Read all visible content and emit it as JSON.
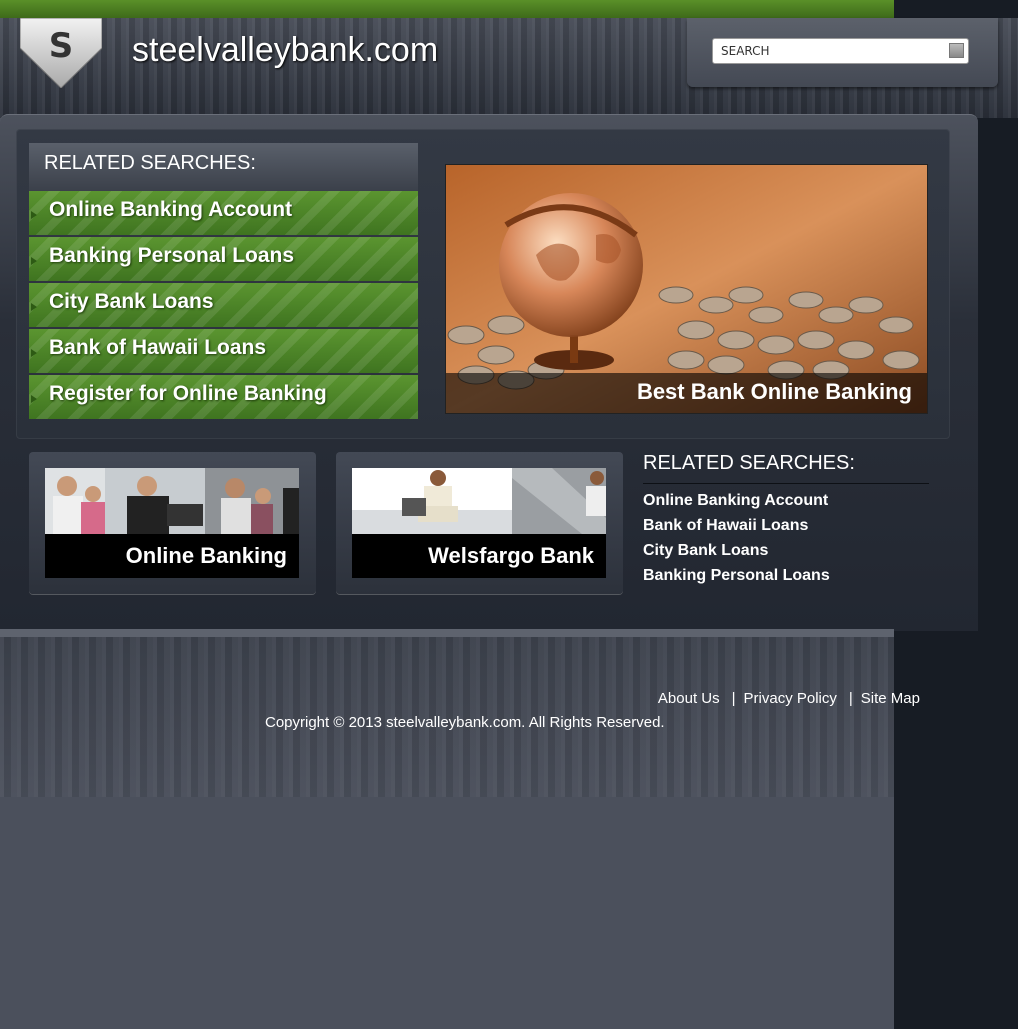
{
  "header": {
    "logo_letter": "S",
    "site_title": "steelvalleybank.com",
    "search_placeholder": "SEARCH"
  },
  "left_panel": {
    "heading": "RELATED SEARCHES:",
    "items": [
      "Online Banking Account",
      "Banking Personal Loans",
      "City Bank Loans",
      "Bank of Hawaii Loans",
      "Register for Online Banking"
    ]
  },
  "feature": {
    "caption": "Best Bank Online Banking"
  },
  "cards": [
    {
      "caption": "Online Banking"
    },
    {
      "caption": "Welsfargo Bank"
    }
  ],
  "right_panel": {
    "heading": "RELATED SEARCHES:",
    "links": [
      "Online Banking Account",
      "Bank of Hawaii Loans",
      "City Bank Loans",
      "Banking Personal Loans"
    ]
  },
  "footer": {
    "links": [
      "About Us",
      "Privacy Policy",
      "Site Map"
    ],
    "copyright": "Copyright © 2013 steelvalleybank.com. All Rights Reserved."
  },
  "colors": {
    "accent_green": "#4f8a28",
    "top_bar": "#4a7f22",
    "page_bg": "#4b505c",
    "outer_bg": "#171c24"
  }
}
